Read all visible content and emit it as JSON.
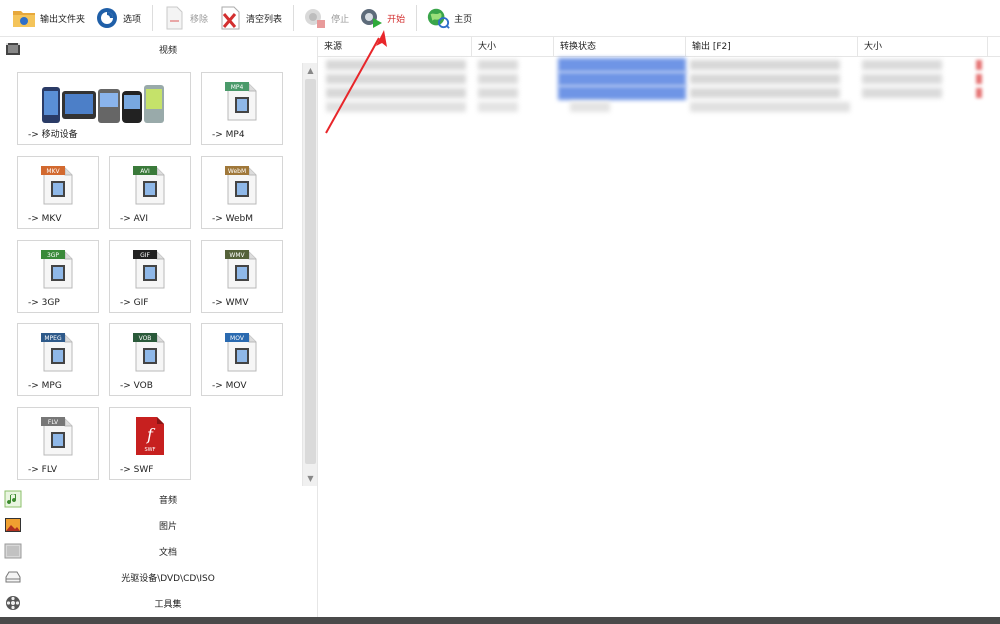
{
  "toolbar": {
    "output_folder": "输出文件夹",
    "options": "选项",
    "remove": "移除",
    "clear_list": "清空列表",
    "stop": "停止",
    "start": "开始",
    "home": "主页"
  },
  "sidebar": {
    "video_header": "视频",
    "tiles": [
      {
        "label": "-> 移动设备",
        "icon": "mobile-devices-icon"
      },
      {
        "label": "-> MP4",
        "icon": "mp4-file-icon",
        "badge": "MP4"
      },
      {
        "label": "-> MKV",
        "icon": "mkv-file-icon",
        "badge": "MKV"
      },
      {
        "label": "-> AVI",
        "icon": "avi-file-icon",
        "badge": "AVI"
      },
      {
        "label": "-> WebM",
        "icon": "webm-file-icon",
        "badge": "WebM"
      },
      {
        "label": "-> 3GP",
        "icon": "3gp-file-icon",
        "badge": "3GP"
      },
      {
        "label": "-> GIF",
        "icon": "gif-file-icon",
        "badge": "GIF"
      },
      {
        "label": "-> WMV",
        "icon": "wmv-file-icon",
        "badge": "WMV"
      },
      {
        "label": "-> MPG",
        "icon": "mpg-file-icon",
        "badge": "MPEG"
      },
      {
        "label": "-> VOB",
        "icon": "vob-file-icon",
        "badge": "VOB"
      },
      {
        "label": "-> MOV",
        "icon": "mov-file-icon",
        "badge": "MOV"
      },
      {
        "label": "-> FLV",
        "icon": "flv-file-icon",
        "badge": "FLV"
      },
      {
        "label": "-> SWF",
        "icon": "swf-file-icon",
        "badge": "SWF"
      }
    ],
    "categories": [
      {
        "label": "音频",
        "icon": "music-note-icon"
      },
      {
        "label": "图片",
        "icon": "picture-icon"
      },
      {
        "label": "文档",
        "icon": "document-icon"
      },
      {
        "label": "光驱设备\\DVD\\CD\\ISO",
        "icon": "optical-drive-icon"
      },
      {
        "label": "工具集",
        "icon": "tools-reel-icon"
      }
    ]
  },
  "file_list": {
    "columns": [
      "来源",
      "大小",
      "转换状态",
      "输出 [F2]",
      "大小"
    ]
  },
  "colors": {
    "accent_blue": "#6f95e6",
    "start_red": "#d32f2f",
    "annotation_red": "#e8262a",
    "tile_border": "#d6d6d6"
  }
}
